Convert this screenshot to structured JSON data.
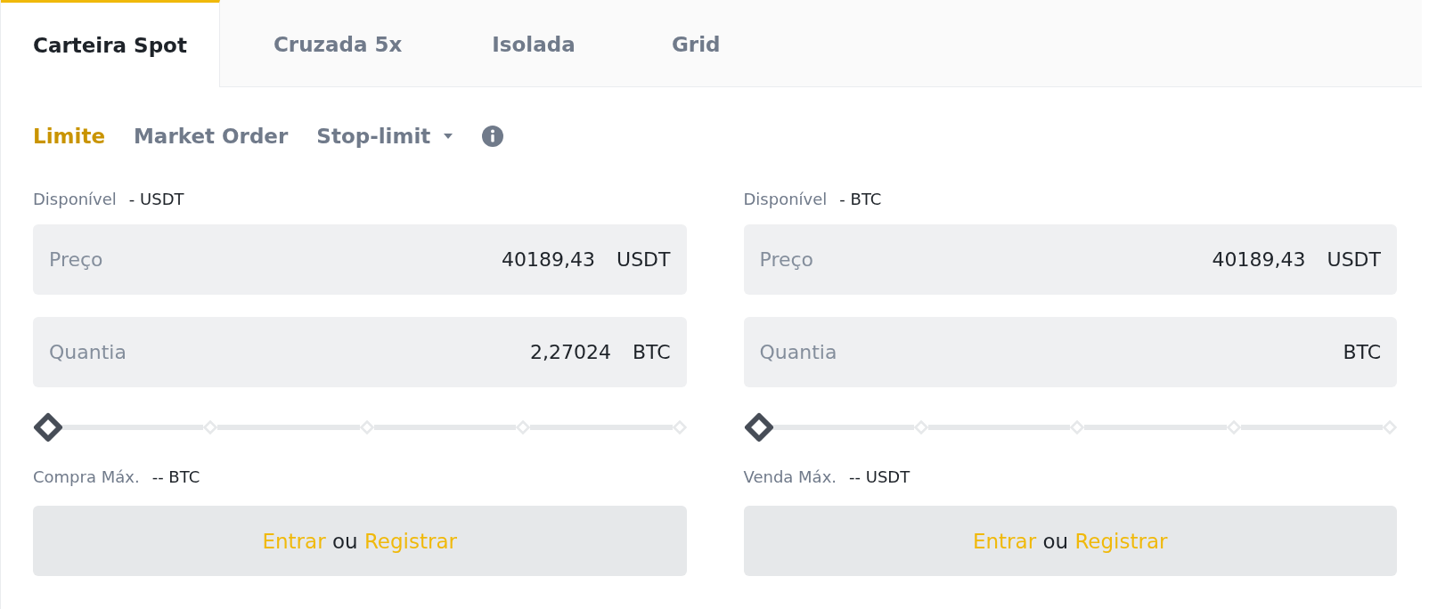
{
  "wallet_tabs": [
    {
      "label": "Carteira Spot",
      "selected": true
    },
    {
      "label": "Cruzada 5x",
      "selected": false
    },
    {
      "label": "Isolada",
      "selected": false
    },
    {
      "label": "Grid",
      "selected": false
    }
  ],
  "order_types": [
    {
      "label": "Limite",
      "selected": true,
      "kind": "plain"
    },
    {
      "label": "Market Order",
      "selected": false,
      "kind": "plain"
    },
    {
      "label": "Stop-limit",
      "selected": false,
      "kind": "dropdown"
    }
  ],
  "columns": [
    {
      "available_label": "Disponível",
      "available_value": "- USDT",
      "fields": [
        {
          "label": "Preço",
          "value": "40189,43",
          "unit": "USDT"
        },
        {
          "label": "Quantia",
          "value": "2,27024",
          "unit": "BTC"
        }
      ],
      "slider": {
        "level": 0
      },
      "max_label": "Compra Máx.",
      "max_value": "-- BTC",
      "login_link": "Entrar",
      "joiner": "ou",
      "register_link": "Registrar"
    },
    {
      "available_label": "Disponível",
      "available_value": "- BTC",
      "fields": [
        {
          "label": "Preço",
          "value": "40189,43",
          "unit": "USDT"
        },
        {
          "label": "Quantia",
          "unit": "BTC"
        }
      ],
      "slider": {
        "level": 0
      },
      "max_label": "Venda Máx.",
      "max_value": "-- USDT",
      "login_link": "Entrar",
      "joiner": "ou",
      "register_link": "Registrar"
    }
  ]
}
